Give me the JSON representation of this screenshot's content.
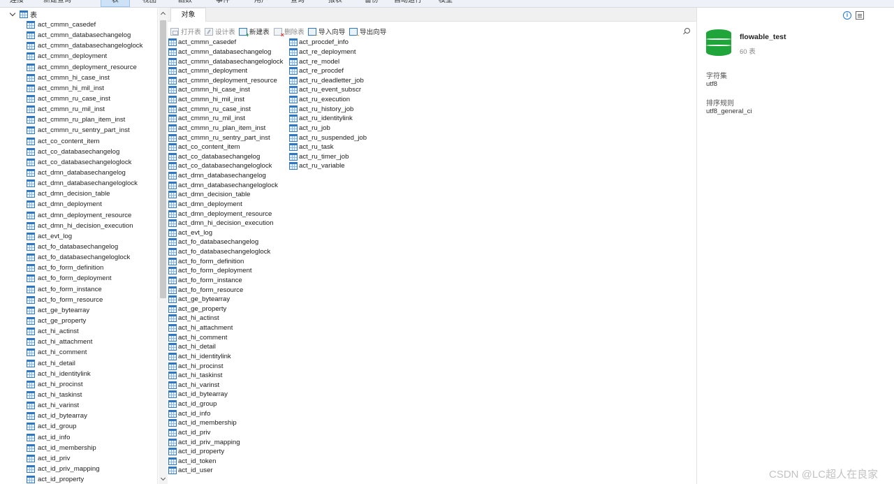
{
  "menubar": {
    "items": [
      {
        "label": "连接",
        "active": false
      },
      {
        "label": "新建查询",
        "active": false
      },
      {
        "label": "表",
        "active": true
      },
      {
        "label": "视图",
        "active": false
      },
      {
        "label": "函数",
        "active": false
      },
      {
        "label": "事件",
        "active": false
      },
      {
        "label": "用户",
        "active": false
      },
      {
        "label": "查询",
        "active": false
      },
      {
        "label": "报表",
        "active": false
      },
      {
        "label": "备份",
        "active": false
      },
      {
        "label": "自动运行",
        "active": false
      },
      {
        "label": "模型",
        "active": false
      }
    ]
  },
  "tree": {
    "root_label": "表",
    "items": [
      "act_cmmn_casedef",
      "act_cmmn_databasechangelog",
      "act_cmmn_databasechangeloglock",
      "act_cmmn_deployment",
      "act_cmmn_deployment_resource",
      "act_cmmn_hi_case_inst",
      "act_cmmn_hi_mil_inst",
      "act_cmmn_ru_case_inst",
      "act_cmmn_ru_mil_inst",
      "act_cmmn_ru_plan_item_inst",
      "act_cmmn_ru_sentry_part_inst",
      "act_co_content_item",
      "act_co_databasechangelog",
      "act_co_databasechangeloglock",
      "act_dmn_databasechangelog",
      "act_dmn_databasechangeloglock",
      "act_dmn_decision_table",
      "act_dmn_deployment",
      "act_dmn_deployment_resource",
      "act_dmn_hi_decision_execution",
      "act_evt_log",
      "act_fo_databasechangelog",
      "act_fo_databasechangeloglock",
      "act_fo_form_definition",
      "act_fo_form_deployment",
      "act_fo_form_instance",
      "act_fo_form_resource",
      "act_ge_bytearray",
      "act_ge_property",
      "act_hi_actinst",
      "act_hi_attachment",
      "act_hi_comment",
      "act_hi_detail",
      "act_hi_identitylink",
      "act_hi_procinst",
      "act_hi_taskinst",
      "act_hi_varinst",
      "act_id_bytearray",
      "act_id_group",
      "act_id_info",
      "act_id_membership",
      "act_id_priv",
      "act_id_priv_mapping",
      "act_id_property"
    ]
  },
  "tab": {
    "label": "对象"
  },
  "toolbar": {
    "open_label": "打开表",
    "design_label": "设计表",
    "new_label": "新建表",
    "delete_label": "删除表",
    "import_label": "导入向导",
    "export_label": "导出向导"
  },
  "objects": {
    "column1": [
      "act_cmmn_casedef",
      "act_cmmn_databasechangelog",
      "act_cmmn_databasechangeloglock",
      "act_cmmn_deployment",
      "act_cmmn_deployment_resource",
      "act_cmmn_hi_case_inst",
      "act_cmmn_hi_mil_inst",
      "act_cmmn_ru_case_inst",
      "act_cmmn_ru_mil_inst",
      "act_cmmn_ru_plan_item_inst",
      "act_cmmn_ru_sentry_part_inst",
      "act_co_content_item",
      "act_co_databasechangelog",
      "act_co_databasechangeloglock",
      "act_dmn_databasechangelog",
      "act_dmn_databasechangeloglock",
      "act_dmn_decision_table",
      "act_dmn_deployment",
      "act_dmn_deployment_resource",
      "act_dmn_hi_decision_execution",
      "act_evt_log",
      "act_fo_databasechangelog",
      "act_fo_databasechangeloglock",
      "act_fo_form_definition",
      "act_fo_form_deployment",
      "act_fo_form_instance",
      "act_fo_form_resource",
      "act_ge_bytearray",
      "act_ge_property",
      "act_hi_actinst",
      "act_hi_attachment",
      "act_hi_comment",
      "act_hi_detail",
      "act_hi_identitylink",
      "act_hi_procinst",
      "act_hi_taskinst",
      "act_hi_varinst",
      "act_id_bytearray",
      "act_id_group",
      "act_id_info",
      "act_id_membership",
      "act_id_priv",
      "act_id_priv_mapping",
      "act_id_property",
      "act_id_token",
      "act_id_user"
    ],
    "column2": [
      "act_procdef_info",
      "act_re_deployment",
      "act_re_model",
      "act_re_procdef",
      "act_ru_deadletter_job",
      "act_ru_event_subscr",
      "act_ru_execution",
      "act_ru_history_job",
      "act_ru_identitylink",
      "act_ru_job",
      "act_ru_suspended_job",
      "act_ru_task",
      "act_ru_timer_job",
      "act_ru_variable"
    ]
  },
  "info_panel": {
    "db_name": "flowable_test",
    "table_count": "60 表",
    "charset_label": "字符集",
    "charset_value": "utf8",
    "collation_label": "排序规则",
    "collation_value": "utf8_general_ci",
    "db_icon_color": "#1fa53a",
    "info_icon_glyph": "i"
  },
  "watermark": "CSDN @LC超人在良家"
}
